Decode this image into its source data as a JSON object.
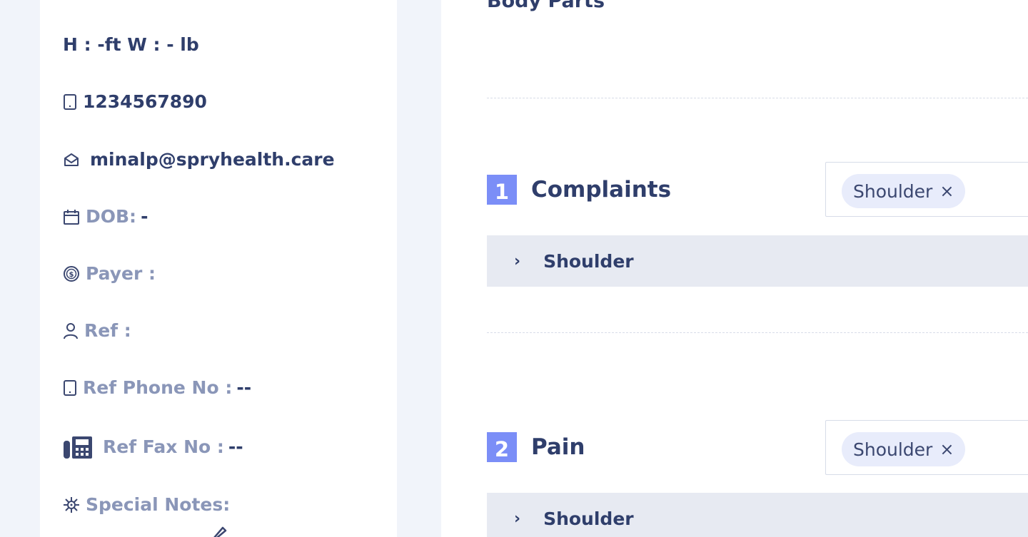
{
  "patient": {
    "height_weight": "H : -ft W : - lb",
    "phone": "1234567890",
    "email": "minalp@spryhealth.care",
    "dob_label": "DOB:",
    "dob_value": "-",
    "payer_label": "Payer :",
    "ref_label": "Ref :",
    "ref_phone_label": "Ref Phone No :",
    "ref_phone_value": "--",
    "ref_fax_label": "Ref Fax No :",
    "ref_fax_value": "--",
    "notes_label": "Special Notes:"
  },
  "main": {
    "heading": "Body Parts",
    "blocks": [
      {
        "number": "1",
        "title": "Complaints",
        "chip": "Shoulder",
        "chip_close": "×",
        "accordion_label": "Shoulder",
        "chevron": "›"
      },
      {
        "number": "2",
        "title": "Pain",
        "chip": "Shoulder",
        "chip_close": "×",
        "accordion_label": "Shoulder",
        "chevron": "›"
      }
    ]
  },
  "icons": [
    "tablet-icon",
    "mail-open-icon",
    "calendar-icon",
    "dollar-circle-icon",
    "user-icon",
    "fax-icon",
    "virus-icon",
    "pencil-icon"
  ],
  "colors": {
    "accent": "#7b8ef7",
    "text_dark": "#2f3e6b",
    "text_muted": "#8a96b8",
    "chip_bg": "#e8ecfb",
    "accordion_bg": "#e7eaf2",
    "page_bg": "#f1f4fa"
  }
}
